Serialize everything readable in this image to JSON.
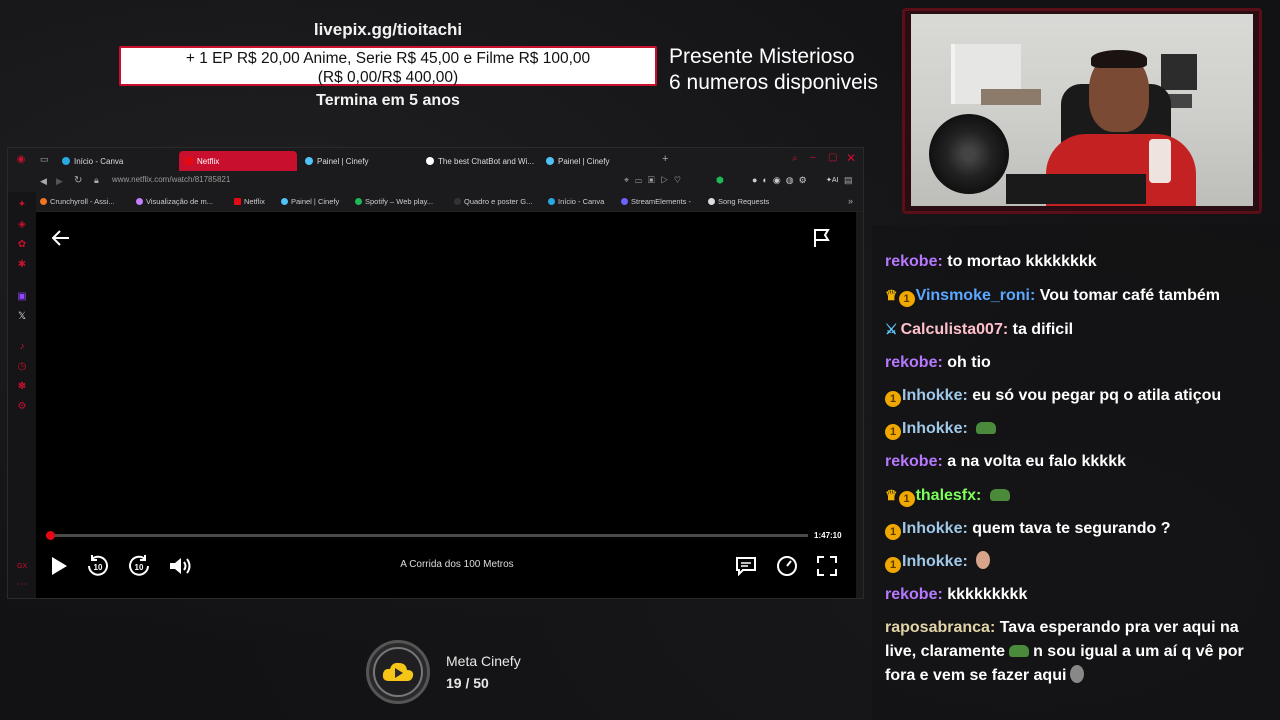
{
  "overlay": {
    "pix_url": "livepix.gg/tioitachi",
    "pix_line1": "+ 1 EP R$ 20,00 Anime, Serie R$ 45,00 e Filme R$ 100,00",
    "pix_line2": "(R$ 0,00/R$ 400,00)",
    "pix_ends": "Termina em 5 anos",
    "mystery_line1": "Presente Misterioso",
    "mystery_line2": "6 numeros disponiveis"
  },
  "browser": {
    "tabs": [
      {
        "label": "Início - Canva",
        "color": "#2aa8e0"
      },
      {
        "label": "Netflix",
        "color": "#e50914"
      },
      {
        "label": "Painel | Cinefy",
        "color": "#4fc3f7"
      },
      {
        "label": "The best ChatBot and Wi...",
        "color": "#ffffff"
      },
      {
        "label": "Painel | Cinefy",
        "color": "#4fc3f7"
      }
    ],
    "url": "www.netflix.com/watch/81785821",
    "bookmarks": [
      {
        "label": "Crunchyroll - Assi...",
        "color": "#f47521"
      },
      {
        "label": "Visualização de m...",
        "color": "#c77dff"
      },
      {
        "label": "Netflix",
        "color": "#e50914"
      },
      {
        "label": "Painel | Cinefy",
        "color": "#4fc3f7"
      },
      {
        "label": "Spotify – Web play...",
        "color": "#1db954"
      },
      {
        "label": "Quadro e poster G...",
        "color": "#333333"
      },
      {
        "label": "Início - Canva",
        "color": "#2aa8e0"
      },
      {
        "label": "StreamElements -",
        "color": "#6c63ff"
      },
      {
        "label": "Song Requests",
        "color": "#dddddd"
      }
    ]
  },
  "player": {
    "time_remaining": "1:47:10",
    "title": "A Corrida dos 100 Metros",
    "progress": 0.005
  },
  "goal": {
    "title": "Meta Cinefy",
    "count": "19 / 50"
  },
  "chat": [
    {
      "badges": [],
      "user": "rekobe:",
      "color": "#b678ff",
      "text": "to mortao kkkkkkkk"
    },
    {
      "badges": [
        "crown",
        "1"
      ],
      "user": "Vinsmoke_roni:",
      "color": "#5aa8ff",
      "text": "Vou tomar café também"
    },
    {
      "badges": [
        "sword"
      ],
      "user": "Calculista007:",
      "color": "#ffc0cb",
      "text": "ta dificil"
    },
    {
      "badges": [],
      "user": "rekobe:",
      "color": "#b678ff",
      "text": "oh tio"
    },
    {
      "badges": [
        "1"
      ],
      "user": "Inhokke:",
      "color": "#9fc8e8",
      "text": "eu só vou pegar pq o atila atiçou"
    },
    {
      "badges": [
        "1"
      ],
      "user": "Inhokke:",
      "color": "#9fc8e8",
      "text": "",
      "emote": "pepe"
    },
    {
      "badges": [],
      "user": "rekobe:",
      "color": "#b678ff",
      "text": "a na volta eu falo kkkkk"
    },
    {
      "badges": [
        "crown",
        "1"
      ],
      "user": "thalesfx:",
      "color": "#7dff5a",
      "text": "",
      "emote": "pepe"
    },
    {
      "badges": [
        "1"
      ],
      "user": "Inhokke:",
      "color": "#9fc8e8",
      "text": "quem tava te segurando ?"
    },
    {
      "badges": [
        "1"
      ],
      "user": "Inhokke:",
      "color": "#9fc8e8",
      "text": "",
      "emote": "face"
    },
    {
      "badges": [],
      "user": "rekobe:",
      "color": "#b678ff",
      "text": "kkkkkkkkk"
    },
    {
      "badges": [],
      "user": "raposabranca:",
      "color": "#e3d4a8",
      "text_a": "Tava esperando pra ver aqui na live, claramente",
      "text_b": "n sou igual a um aí q vê por fora e vem se fazer aqui"
    }
  ]
}
